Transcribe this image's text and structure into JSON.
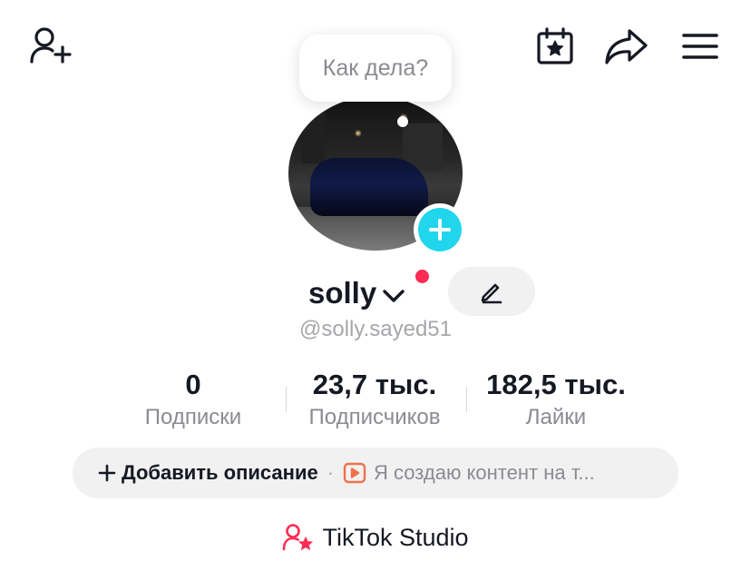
{
  "header": {
    "icons": [
      "add-friend-icon",
      "calendar-star-icon",
      "share-icon",
      "menu-icon"
    ]
  },
  "bubble": {
    "text": "Как дела?"
  },
  "profile": {
    "display_name": "solly",
    "username": "@solly.sayed51"
  },
  "stats": [
    {
      "value": "0",
      "label": "Подписки"
    },
    {
      "value": "23,7 тыс.",
      "label": "Подписчиков"
    },
    {
      "value": "182,5 тыс.",
      "label": "Лайки"
    }
  ],
  "bio": {
    "add_label": "Добавить описание",
    "separator": "·",
    "promo_text": "Я создаю контент на т..."
  },
  "studio": {
    "label": "TikTok Studio"
  },
  "colors": {
    "accent_red": "#fe2c55",
    "accent_cyan": "#20d5ec",
    "text_primary": "#161823",
    "text_secondary": "#8a8b91",
    "chip_bg": "#f1f1f2",
    "promo_icon": "#f0714b"
  }
}
